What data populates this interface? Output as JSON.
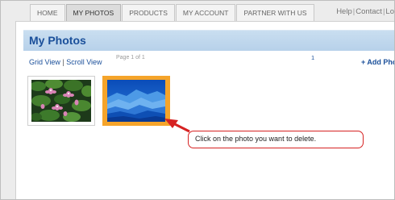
{
  "nav": {
    "tabs": [
      {
        "label": "HOME",
        "active": false
      },
      {
        "label": "MY PHOTOS",
        "active": true
      },
      {
        "label": "PRODUCTS",
        "active": false
      },
      {
        "label": "MY ACCOUNT",
        "active": false
      },
      {
        "label": "PARTNER WITH US",
        "active": false
      }
    ],
    "links": [
      "Help",
      "Contact",
      "Lo"
    ]
  },
  "page": {
    "title": "My Photos",
    "views": {
      "grid": "Grid View",
      "scroll": "Scroll View"
    },
    "page_info": "Page 1 of 1",
    "page_number": "1",
    "add_photos": "+ Add Pho"
  },
  "callout": {
    "text": "Click on the photo you want to delete."
  },
  "colors": {
    "accent": "#1a4f9a",
    "highlight": "#f5a42a",
    "callout_border": "#d62222"
  }
}
